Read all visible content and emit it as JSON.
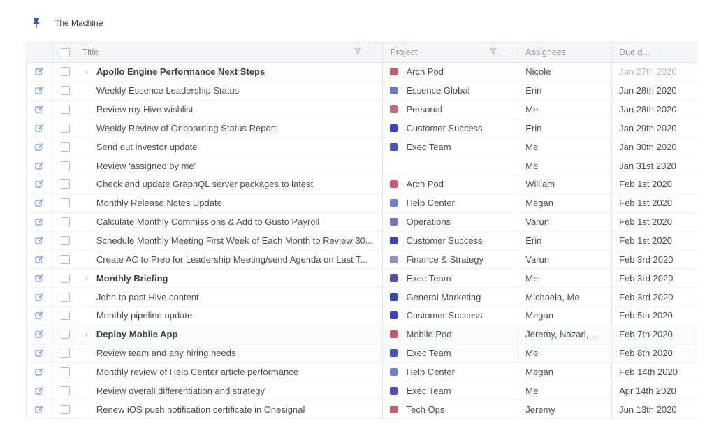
{
  "workspace": {
    "title": "The Machine",
    "pin_icon": "pushpin-icon"
  },
  "columns": {
    "title": "Title",
    "project": "Project",
    "assignees": "Assignees",
    "due": "Due d..."
  },
  "rows": [
    {
      "title": "Apollo Engine Performance Next Steps",
      "bold": true,
      "expandable": true,
      "project": "Arch Pod",
      "project_color": "#c85a6a",
      "assignees": "Nicole",
      "due": "Jan 27th 2020",
      "due_faded": true
    },
    {
      "title": "Weekly Essence Leadership Status",
      "bold": false,
      "expandable": false,
      "project": "Essence Global",
      "project_color": "#6a76c8",
      "assignees": "Erin",
      "due": "Jan 28th 2020",
      "due_faded": false
    },
    {
      "title": "Review my Hive wishlist",
      "bold": false,
      "expandable": false,
      "project": "Personal",
      "project_color": "#c86a7a",
      "assignees": "Me",
      "due": "Jan 28th 2020",
      "due_faded": false
    },
    {
      "title": "Weekly Review of Onboarding Status Report",
      "bold": false,
      "expandable": false,
      "project": "Customer Success",
      "project_color": "#3c40c8",
      "assignees": "Erin",
      "due": "Jan 29th 2020",
      "due_faded": false
    },
    {
      "title": "Send out investor update",
      "bold": false,
      "expandable": false,
      "project": "Exec Team",
      "project_color": "#4a52b8",
      "assignees": "Me",
      "due": "Jan 30th 2020",
      "due_faded": false
    },
    {
      "title": "Review 'assigned by me'",
      "bold": false,
      "expandable": false,
      "project": "",
      "project_color": "",
      "assignees": "Me",
      "due": "Jan 31st 2020",
      "due_faded": false
    },
    {
      "title": "Check and update GraphQL server packages to latest",
      "bold": false,
      "expandable": false,
      "project": "Arch Pod",
      "project_color": "#c85a6a",
      "assignees": "William",
      "due": "Feb 1st 2020",
      "due_faded": false
    },
    {
      "title": "Monthly Release Notes Update",
      "bold": false,
      "expandable": false,
      "project": "Help Center",
      "project_color": "#6a82c8",
      "assignees": "Megan",
      "due": "Feb 1st 2020",
      "due_faded": false
    },
    {
      "title": "Calculate Monthly Commissions & Add to Gusto Payroll",
      "bold": false,
      "expandable": false,
      "project": "Operations",
      "project_color": "#7a72b8",
      "assignees": "Varun",
      "due": "Feb 1st 2020",
      "due_faded": false
    },
    {
      "title": "Schedule Monthly Meeting First Week of Each Month to Review 30...",
      "bold": false,
      "expandable": false,
      "project": "Customer Success",
      "project_color": "#3c40c8",
      "assignees": "Erin",
      "due": "Feb 1st 2020",
      "due_faded": false
    },
    {
      "title": "Create AC to Prep for Leadership Meeting/send Agenda on Last T...",
      "bold": false,
      "expandable": false,
      "project": "Finance & Strategy",
      "project_color": "#8a92c0",
      "assignees": "Varun",
      "due": "Feb 3rd 2020",
      "due_faded": false
    },
    {
      "title": "Monthly Briefing",
      "bold": true,
      "expandable": true,
      "project": "Exec Team",
      "project_color": "#4a52b8",
      "assignees": "Me",
      "due": "Feb 3rd 2020",
      "due_faded": false
    },
    {
      "title": "John to post Hive content",
      "bold": false,
      "expandable": false,
      "project": "General Marketing",
      "project_color": "#3a48c0",
      "assignees": "Michaela, Me",
      "due": "Feb 3rd 2020",
      "due_faded": false
    },
    {
      "title": "Monthly pipeline update",
      "bold": false,
      "expandable": false,
      "project": "Customer Success",
      "project_color": "#3c40c8",
      "assignees": "Megan",
      "due": "Feb 5th 2020",
      "due_faded": false
    },
    {
      "title": "Deploy Mobile App",
      "bold": true,
      "expandable": true,
      "project": "Mobile Pod",
      "project_color": "#c85a6a",
      "assignees": "Jeremy, Nazari, ...",
      "due": "Feb 7th 2020",
      "due_faded": false
    },
    {
      "title": "Review team and any hiring needs",
      "bold": false,
      "expandable": false,
      "project": "Exec Team",
      "project_color": "#4a52b8",
      "assignees": "Me",
      "due": "Feb 8th 2020",
      "due_faded": false
    },
    {
      "title": "Monthly review of Help Center article performance",
      "bold": false,
      "expandable": false,
      "project": "Help Center",
      "project_color": "#6a82c8",
      "assignees": "Megan",
      "due": "Feb 14th 2020",
      "due_faded": false
    },
    {
      "title": "Review overall differentiation and strategy",
      "bold": false,
      "expandable": false,
      "project": "Exec Team",
      "project_color": "#4a52b8",
      "assignees": "Me",
      "due": "Apr 14th 2020",
      "due_faded": false
    },
    {
      "title": "Renew iOS push notification certificate in Onesignal",
      "bold": false,
      "expandable": false,
      "project": "Tech Ops",
      "project_color": "#c85a6a",
      "assignees": "Jeremy",
      "due": "Jun 13th 2020",
      "due_faded": false
    }
  ],
  "colors": {
    "accent": "#4a6cf0",
    "edit_icon": "#6f8ff5"
  }
}
